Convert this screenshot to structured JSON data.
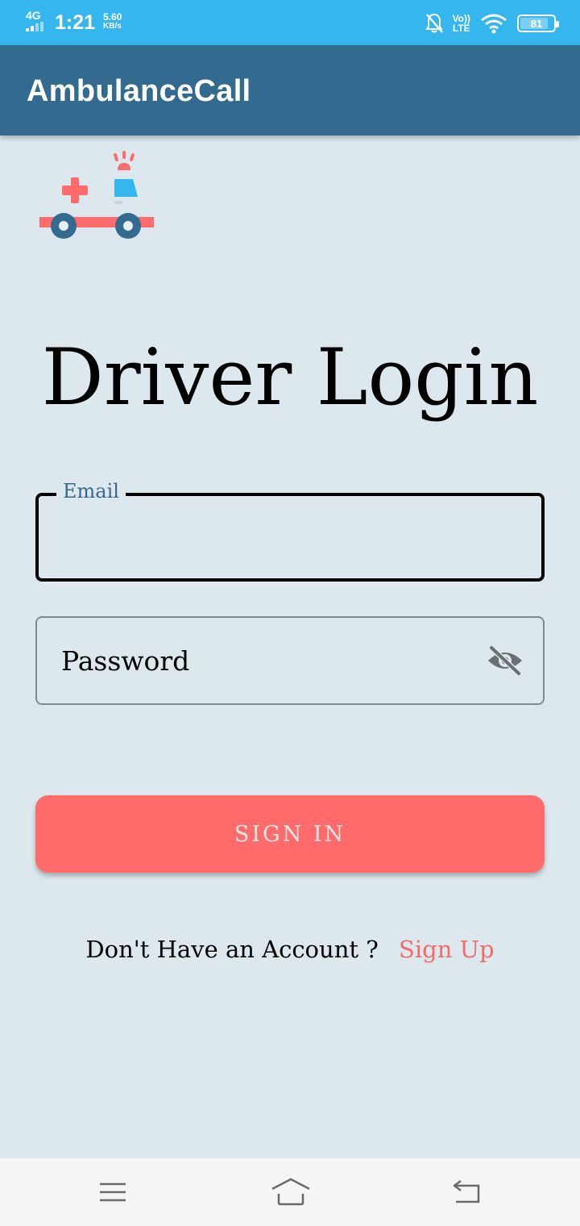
{
  "status_bar": {
    "network": "4G",
    "time": "1:21",
    "speed_value": "5.60",
    "speed_unit": "KB/s",
    "volte": "Vo))",
    "lte": "LTE",
    "battery": "81"
  },
  "app_bar": {
    "title": "AmbulanceCall"
  },
  "login": {
    "heading": "Driver Login",
    "email_label": "Email",
    "email_value": "",
    "password_placeholder": "Password",
    "sign_in_label": "SIGN IN",
    "no_account_text": "Don't Have an Account ?",
    "sign_up_link": "Sign Up"
  },
  "colors": {
    "status_bar": "#35b6ee",
    "app_bar": "#336a8f",
    "background": "#dce7ee",
    "accent": "#ff6b6b",
    "link": "#f26b6b"
  },
  "icons": {
    "logo": "ambulance-icon",
    "password_toggle": "eye-off-icon",
    "nav": [
      "menu-icon",
      "home-icon",
      "back-icon"
    ]
  }
}
